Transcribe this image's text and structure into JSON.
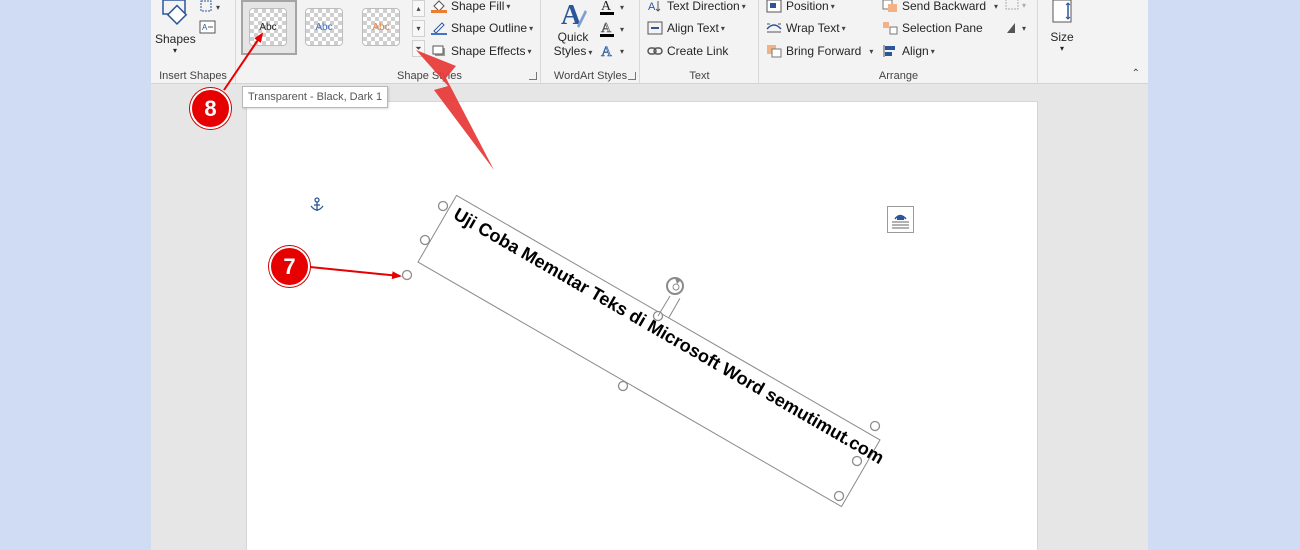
{
  "ribbon": {
    "insert_shapes": {
      "label": "Insert Shapes",
      "shapes_label": "Shapes"
    },
    "shape_styles": {
      "label": "Shape Styles",
      "thumbs": [
        {
          "text": "Abc",
          "color": "#262626",
          "selected": true
        },
        {
          "text": "Abc",
          "color": "#4472c4",
          "selected": false
        },
        {
          "text": "Abc",
          "color": "#ed7d31",
          "selected": false
        }
      ],
      "shape_fill": "Shape Fill",
      "shape_outline": "Shape Outline",
      "shape_effects": "Shape Effects"
    },
    "wordart": {
      "label": "WordArt Styles",
      "quick_styles_line1": "Quick",
      "quick_styles_line2": "Styles"
    },
    "text": {
      "label": "Text",
      "text_direction": "Text Direction",
      "align_text": "Align Text",
      "create_link": "Create Link"
    },
    "arrange": {
      "label": "Arrange",
      "position": "Position",
      "wrap_text": "Wrap Text",
      "bring_forward": "Bring Forward",
      "send_backward": "Send Backward",
      "selection_pane": "Selection Pane",
      "align": "Align"
    },
    "size": {
      "label": "Size"
    }
  },
  "tooltip": "Transparent - Black, Dark 1",
  "document": {
    "rotated_text": "Uji Coba Memutar Teks di Microsoft Word semutimut.com"
  },
  "annotations": {
    "badge_7": "7",
    "badge_8": "8",
    "accent_color": "#e60000"
  }
}
